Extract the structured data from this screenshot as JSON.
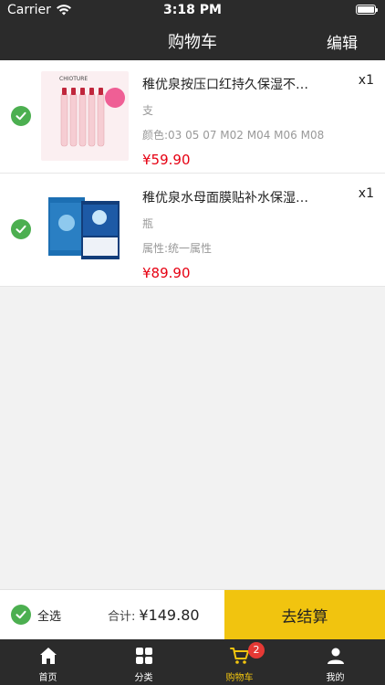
{
  "status_bar": {
    "carrier": "Carrier",
    "time": "3:18 PM"
  },
  "nav": {
    "title": "购物车",
    "edit": "编辑"
  },
  "items": [
    {
      "name": "稚优泉按压口红持久保湿不…",
      "unit": "支",
      "attr": "颜色:03 05 07 M02 M04 M06 M08",
      "price": "¥59.90",
      "qty": "x1",
      "thumb_text": "CHIOTURE"
    },
    {
      "name": "稚优泉水母面膜贴补水保湿…",
      "unit": "瓶",
      "attr": "属性:统一属性",
      "price": "¥89.90",
      "qty": "x1"
    }
  ],
  "footer": {
    "select_all": "全选",
    "total_label": "合计:",
    "total_amount": "¥149.80",
    "checkout": "去结算"
  },
  "tabs": [
    {
      "label": "首页",
      "icon": "home-icon"
    },
    {
      "label": "分类",
      "icon": "grid-icon"
    },
    {
      "label": "购物车",
      "icon": "cart-icon",
      "badge": "2",
      "active": true
    },
    {
      "label": "我的",
      "icon": "person-icon"
    }
  ],
  "colors": {
    "dark": "#2b2b2b",
    "accent": "#f1c40f",
    "price": "#e60012",
    "check": "#4caf50",
    "badge": "#e53935"
  }
}
